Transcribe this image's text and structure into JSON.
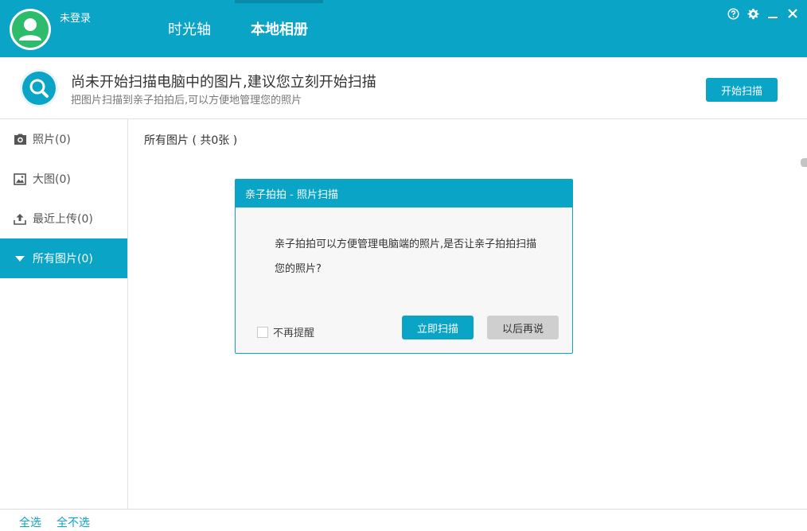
{
  "header": {
    "login_status": "未登录",
    "tabs": [
      {
        "label": "时光轴"
      },
      {
        "label": "本地相册"
      }
    ],
    "active_tab": "本地相册"
  },
  "banner": {
    "title": "尚未开始扫描电脑中的图片,建议您立刻开始扫描",
    "subtitle": "把图片扫描到亲子拍拍后,可以方便地管理您的照片",
    "start_button": "开始扫描"
  },
  "sidebar": {
    "items": [
      {
        "label": "照片(0)",
        "icon": "camera-icon"
      },
      {
        "label": "大图(0)",
        "icon": "image-icon"
      },
      {
        "label": "最近上传(0)",
        "icon": "upload-icon"
      },
      {
        "label": "所有图片(0)",
        "icon": "caret-down-icon",
        "active": true
      }
    ]
  },
  "main": {
    "title": "所有图片 ( 共0张 )"
  },
  "dialog": {
    "title": "亲子拍拍 - 照片扫描",
    "message": "亲子拍拍可以方便管理电脑端的照片,是否让亲子拍拍扫描您的照片?",
    "checkbox_label": "不再提醒",
    "confirm_button": "立即扫描",
    "cancel_button": "以后再说"
  },
  "footer": {
    "select_all": "全选",
    "select_none": "全不选"
  },
  "colors": {
    "accent": "#0aa4c6",
    "avatar_green": "#2dbb6c"
  }
}
